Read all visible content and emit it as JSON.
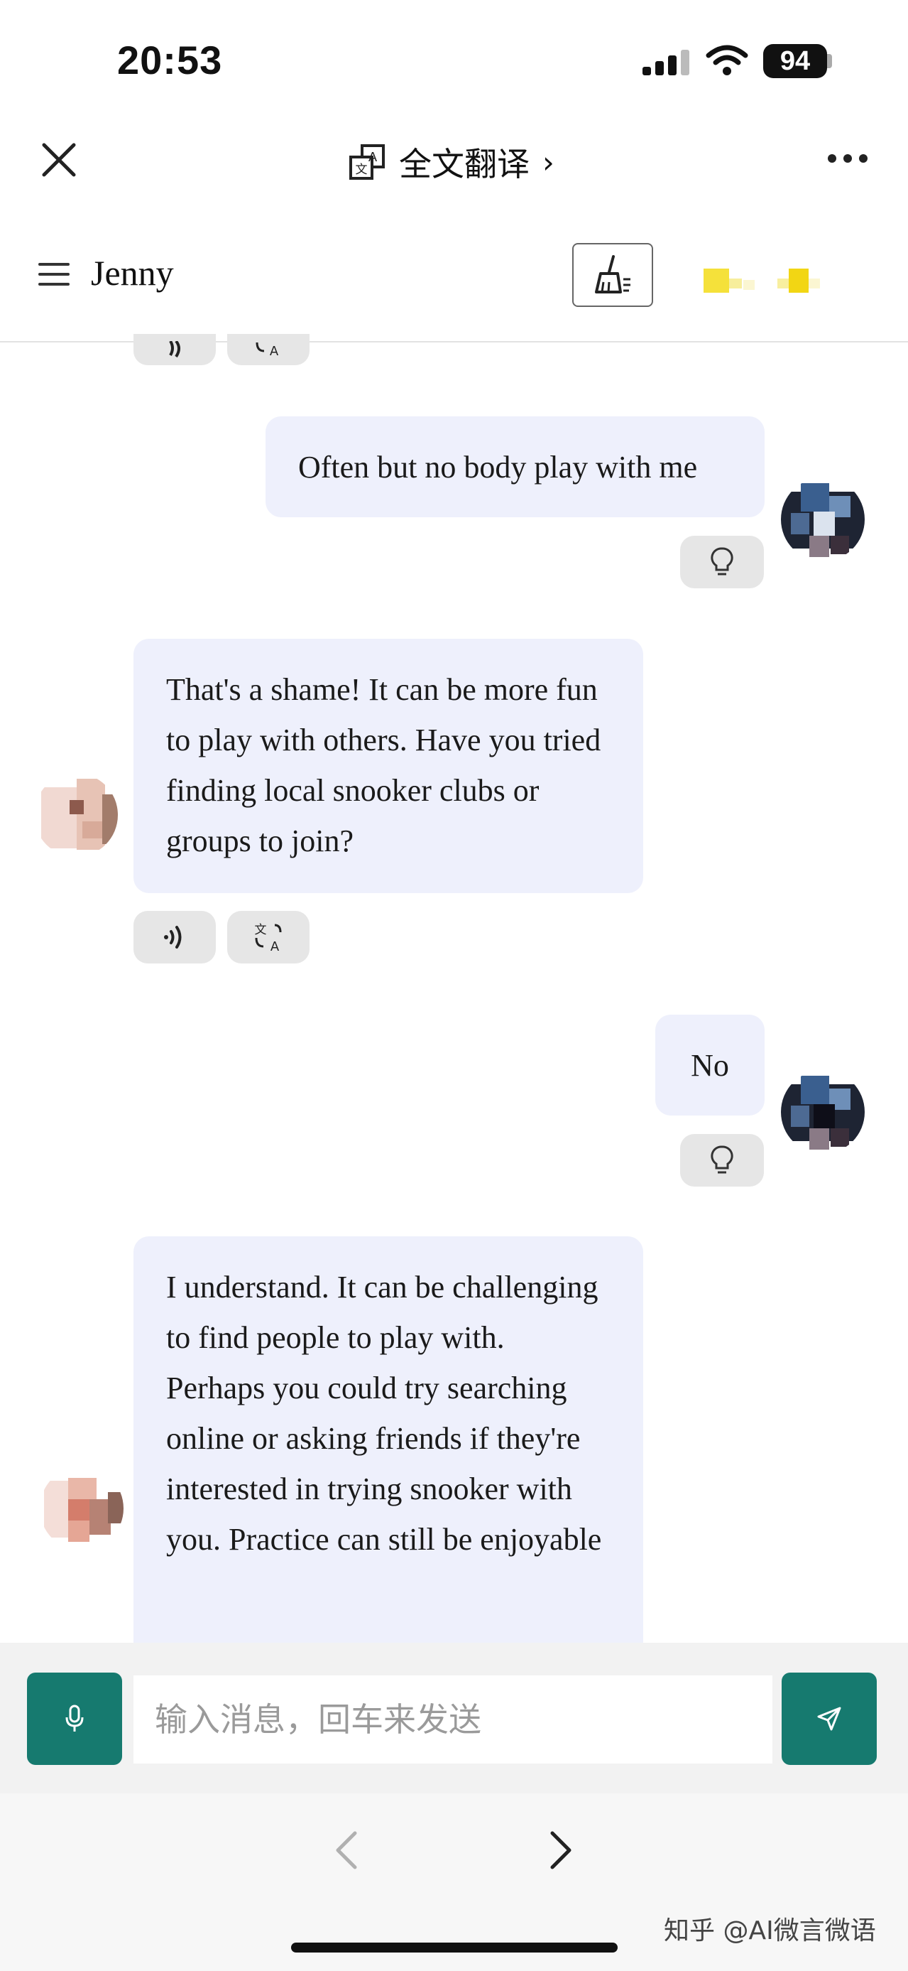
{
  "status_bar": {
    "time": "20:53",
    "battery": "94"
  },
  "browser_bar": {
    "title": "全文翻译"
  },
  "header": {
    "name": "Jenny"
  },
  "messages": [
    {
      "role": "user",
      "text": "Often but no body play with me"
    },
    {
      "role": "bot",
      "text": "That's a shame! It can be more fun to play with others. Have you tried finding local snooker clubs or groups to join?"
    },
    {
      "role": "user",
      "text": "No"
    },
    {
      "role": "bot",
      "text": "I understand. It can be challenging to find people to play with. Perhaps you could try searching online or asking friends if they're interested in trying snooker with you. Practice can still be enjoyable"
    }
  ],
  "composer": {
    "placeholder": "输入消息，回车来发送"
  },
  "watermark": "知乎 @AI微言微语",
  "colors": {
    "accent": "#167a6f",
    "bubble": "#eef0fc"
  }
}
